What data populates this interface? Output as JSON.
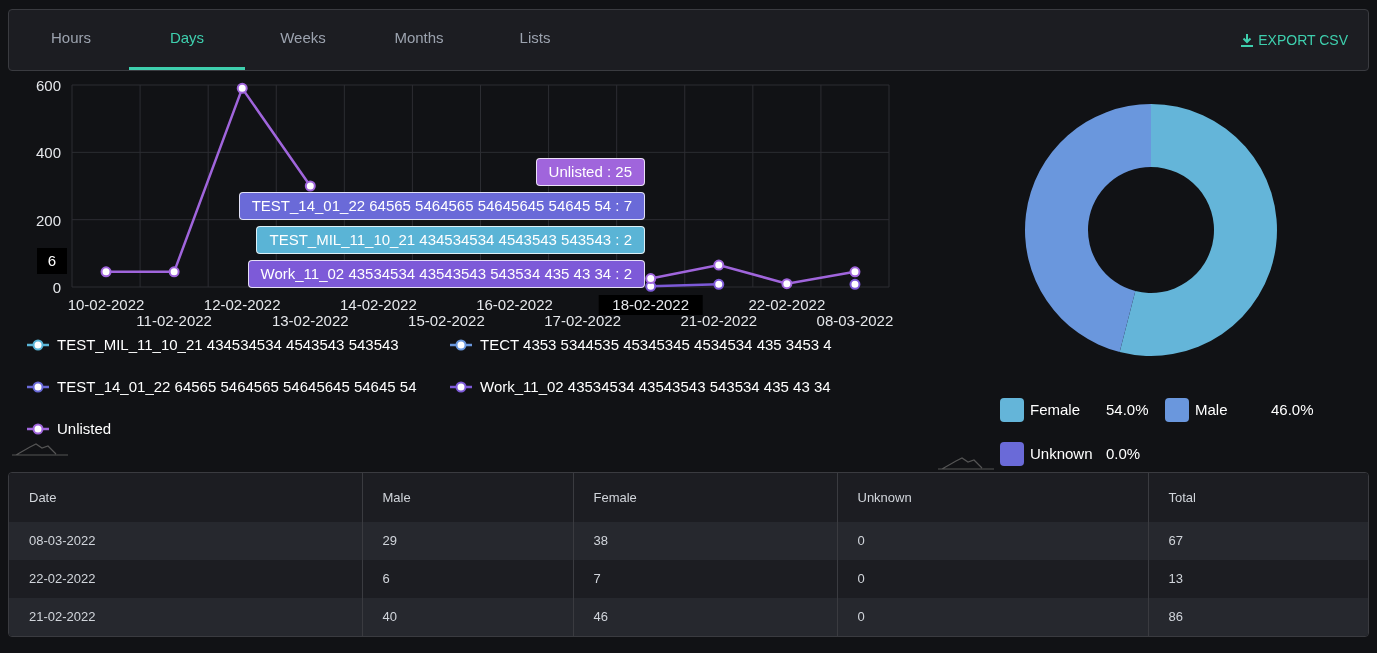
{
  "tabs": [
    {
      "label": "Hours",
      "selected": false
    },
    {
      "label": "Days",
      "selected": true
    },
    {
      "label": "Weeks",
      "selected": false
    },
    {
      "label": "Months",
      "selected": false
    },
    {
      "label": "Lists",
      "selected": false
    }
  ],
  "export_button": {
    "label": "EXPORT CSV"
  },
  "line_chart": {
    "chart_data": {
      "type": "line",
      "categories": [
        "10-02-2022",
        "11-02-2022",
        "12-02-2022",
        "13-02-2022",
        "14-02-2022",
        "15-02-2022",
        "16-02-2022",
        "17-02-2022",
        "18-02-2022",
        "21-02-2022",
        "22-02-2022",
        "08-03-2022"
      ],
      "ylim": [
        0,
        600
      ],
      "yticks": [
        0,
        200,
        400,
        600
      ],
      "series": [
        {
          "name": "TEST_MIL_11_10_21 434534534 4543543 543543",
          "color": "#5ab4d6",
          "marker": "circle",
          "values": [
            null,
            null,
            null,
            null,
            null,
            null,
            null,
            null,
            null,
            null,
            null,
            null
          ]
        },
        {
          "name": "TECT 4353 5344535 45345345 4534534 435 3453 4",
          "color": "#6a97dd",
          "marker": "circle",
          "values": [
            null,
            null,
            null,
            null,
            null,
            null,
            null,
            null,
            null,
            null,
            null,
            null
          ]
        },
        {
          "name": "TEST_14_01_22 64565 5464565 54645645 54645 54",
          "color": "#6a6ad8",
          "marker": "circle",
          "values": [
            null,
            null,
            null,
            null,
            null,
            null,
            null,
            null,
            null,
            null,
            null,
            null
          ]
        },
        {
          "name": "Work_11_02 43534534 43543543 543534 435 43 34",
          "color": "#7d5ad8",
          "marker": "circle",
          "values": [
            null,
            null,
            null,
            null,
            null,
            null,
            null,
            null,
            2,
            8,
            null,
            8
          ]
        },
        {
          "name": "Unlisted",
          "color": "#a065dc",
          "marker": "circle",
          "values": [
            45,
            45,
            590,
            300,
            null,
            null,
            null,
            null,
            25,
            65,
            10,
            45
          ]
        }
      ]
    },
    "tooltip": [
      {
        "text": "Unlisted : 25",
        "color": "#a065dc"
      },
      {
        "text": "TEST_14_01_22 64565 5464565 54645645 54645 54 : 7",
        "color": "#6a6ad8"
      },
      {
        "text": "TEST_MIL_11_10_21 434534534 4543543 543543 : 2",
        "color": "#5ab4d6"
      },
      {
        "text": "Work_11_02 43534534 43543543 543534 435 43 34 : 2",
        "color": "#7d5ad8"
      }
    ],
    "pointer_y_label": "6",
    "x_pointer_on": [
      false,
      false,
      false,
      false,
      false,
      false,
      false,
      false,
      true,
      false,
      false,
      false
    ]
  },
  "donut_chart": {
    "chart_data": {
      "type": "donut",
      "categories": [
        "Female",
        "Male",
        "Unknown"
      ],
      "values": [
        54.0,
        46.0,
        0.0
      ],
      "colors": [
        "#64b5d9",
        "#6a97dd",
        "#6a6ad8"
      ]
    },
    "legend_values": [
      "54.0%",
      "46.0%",
      "0.0%"
    ]
  },
  "table": {
    "columns": [
      "Date",
      "Male",
      "Female",
      "Unknown",
      "Total"
    ],
    "rows": [
      [
        "08-03-2022",
        "29",
        "38",
        "0",
        "67"
      ],
      [
        "22-02-2022",
        "6",
        "7",
        "0",
        "13"
      ],
      [
        "21-02-2022",
        "40",
        "46",
        "0",
        "86"
      ]
    ]
  }
}
